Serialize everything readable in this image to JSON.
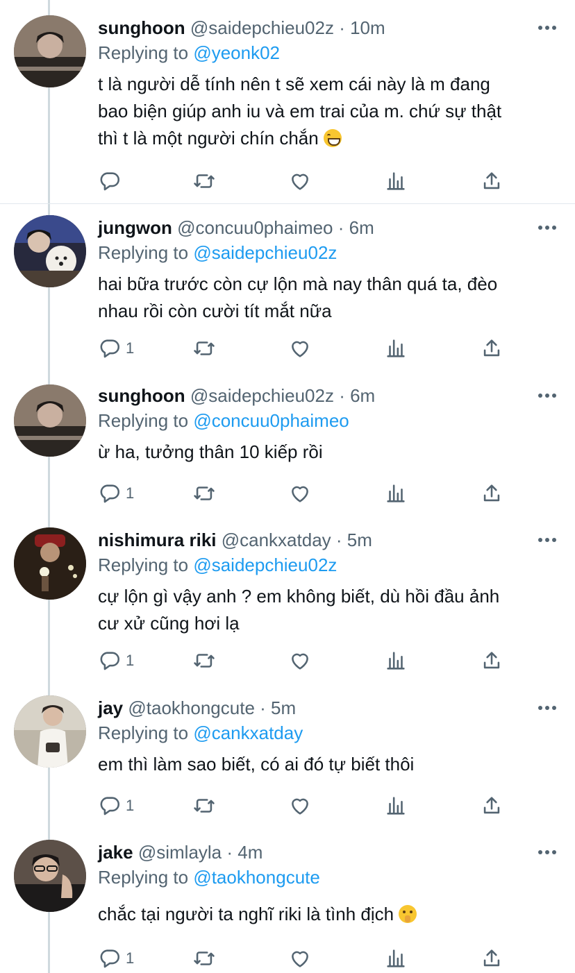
{
  "tweets": [
    {
      "name": "sunghoon",
      "handle": "@saidepchieu02z",
      "time": "10m",
      "replying_label": "Replying to",
      "reply_to": "@yeonk02",
      "lines": [
        "t là người dễ tính nên t sẽ xem cái này là m đang",
        "bao biện giúp anh iu và em trai của m. chứ sự thật",
        "thì t là một người chín chắn"
      ],
      "emoji": "grinning-face",
      "reply_count": "",
      "avatar_colors": [
        "#6d5a4c",
        "#2b2622",
        "#c9b8a8"
      ]
    },
    {
      "name": "jungwon",
      "handle": "@concuu0phaimeo",
      "time": "6m",
      "replying_label": "Replying to",
      "reply_to": "@saidepchieu02z",
      "lines": [
        "hai bữa trước còn cự lộn mà nay thân quá ta, đèo",
        "nhau rồi còn cười tít mắt nữa"
      ],
      "emoji": "",
      "reply_count": "1",
      "avatar_colors": [
        "#3a4a8c",
        "#1b1d2e",
        "#f2efe9"
      ]
    },
    {
      "name": "sunghoon",
      "handle": "@saidepchieu02z",
      "time": "6m",
      "replying_label": "Replying to",
      "reply_to": "@concuu0phaimeo",
      "lines": [
        "ừ ha, tưởng thân 10 kiếp rồi"
      ],
      "emoji": "",
      "reply_count": "1",
      "avatar_colors": [
        "#6d5a4c",
        "#2b2622",
        "#c9b8a8"
      ]
    },
    {
      "name": "nishimura riki",
      "handle": "@cankxatday",
      "time": "5m",
      "replying_label": "Replying to",
      "reply_to": "@saidepchieu02z",
      "lines": [
        "cự lộn gì vậy anh ? em không biết, dù hồi đầu ảnh",
        "cư xử cũng hơi lạ"
      ],
      "emoji": "",
      "reply_count": "1",
      "avatar_colors": [
        "#2a1f16",
        "#120c08",
        "#e8e2c0"
      ]
    },
    {
      "name": "jay",
      "handle": "@taokhongcute",
      "time": "5m",
      "replying_label": "Replying to",
      "reply_to": "@cankxatday",
      "lines": [
        "em thì làm sao biết, có ai đó tự biết thôi"
      ],
      "emoji": "",
      "reply_count": "1",
      "avatar_colors": [
        "#d8d3c8",
        "#f5f3ee",
        "#3a3430"
      ]
    },
    {
      "name": "jake",
      "handle": "@simlayla",
      "time": "4m",
      "replying_label": "Replying to",
      "reply_to": "@taokhongcute",
      "lines": [
        "chắc tại người ta nghĩ riki là tình địch"
      ],
      "emoji": "shushing-face",
      "reply_count": "1",
      "avatar_colors": [
        "#5c5048",
        "#1c1a1a",
        "#d6b8a2"
      ]
    }
  ],
  "icons": {
    "reply": "reply-icon",
    "retweet": "retweet-icon",
    "like": "heart-icon",
    "stats": "analytics-icon",
    "share": "share-icon",
    "more": "more-icon"
  },
  "colors": {
    "mention": "#1d9bf0",
    "secondary_text": "#536471",
    "divider": "#e1e8ed",
    "thread_line": "#cfd9de"
  }
}
